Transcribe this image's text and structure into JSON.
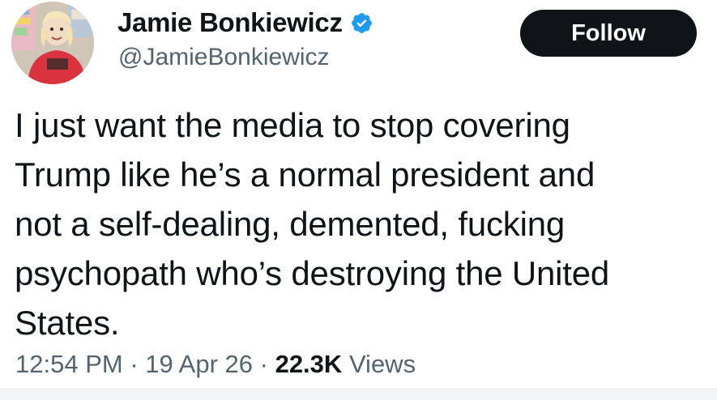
{
  "author": {
    "display_name": "Jamie Bonkiewicz",
    "handle": "@JamieBonkiewicz",
    "verified": true,
    "avatar_icon": "profile-photo"
  },
  "actions": {
    "follow_label": "Follow"
  },
  "tweet": {
    "lines": [
      "I just want the media to stop covering",
      "Trump like he’s a normal president and",
      "not a self-dealing, demented, fucking",
      "psychopath who’s destroying the United",
      "States."
    ]
  },
  "meta": {
    "time": "12:54 PM",
    "separator": "·",
    "date": "19 Apr 26",
    "views_count": "22.3K",
    "views_label": "Views"
  },
  "colors": {
    "text_primary": "#0f1419",
    "text_secondary": "#536471",
    "verified_blue": "#1d9bf0",
    "button_bg": "#0f1419"
  }
}
